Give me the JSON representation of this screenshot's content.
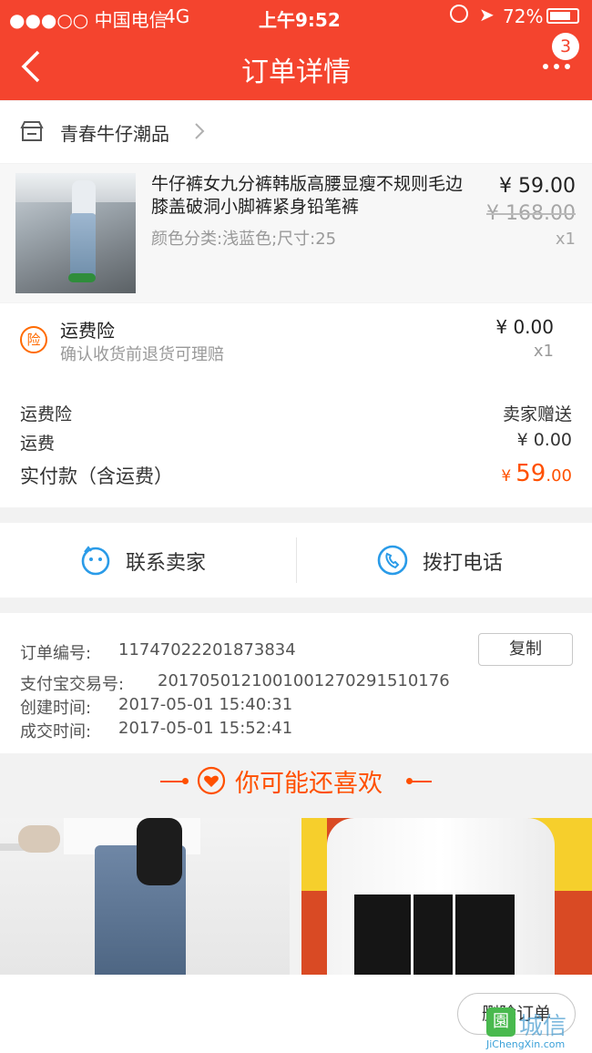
{
  "status_bar": {
    "carrier": "●●●○○ 中国电信",
    "network": "4G",
    "time": "上午9:52",
    "battery": "72%"
  },
  "nav": {
    "title": "订单详情",
    "badge": "3"
  },
  "shop": {
    "name": "青春牛仔潮品"
  },
  "product": {
    "title": "牛仔裤女九分裤韩版高腰显瘦不规则毛边膝盖破洞小脚裤紧身铅笔裤",
    "spec": "颜色分类:浅蓝色;尺寸:25",
    "price": "¥ 59.00",
    "original_price": "¥ 168.00",
    "qty": "x1"
  },
  "insurance": {
    "icon_label": "险",
    "title": "运费险",
    "subtitle": "确认收货前退货可理赔",
    "price": "¥ 0.00",
    "qty": "x1"
  },
  "summary": {
    "insurance_label": "运费险",
    "insurance_value": "卖家赠送",
    "shipping_label": "运费",
    "shipping_value": "¥ 0.00",
    "paid_label": "实付款（含运费）",
    "paid_currency": "¥",
    "paid_integer": "59",
    "paid_decimal": ".00"
  },
  "contact": {
    "seller_label": "联系卖家",
    "phone_label": "拨打电话"
  },
  "order_info": {
    "order_no_label": "订单编号:",
    "order_no": "11747022201873834",
    "copy_label": "复制",
    "alipay_label": "支付宝交易号:",
    "alipay_no": "2017050121001001270291510176",
    "created_label": "创建时间:",
    "created_time": "2017-05-01 15:40:31",
    "closed_label": "成交时间:",
    "closed_time": "2017-05-01 15:52:41"
  },
  "recommend": {
    "title": "你可能还喜欢"
  },
  "footer": {
    "delete_label": "删除订单"
  },
  "watermark": {
    "text": "城信",
    "url": "JiChengXin.com"
  },
  "colors": {
    "brand": "#f4442e",
    "accent_orange": "#ff5000",
    "icon_blue": "#2a9be8"
  }
}
